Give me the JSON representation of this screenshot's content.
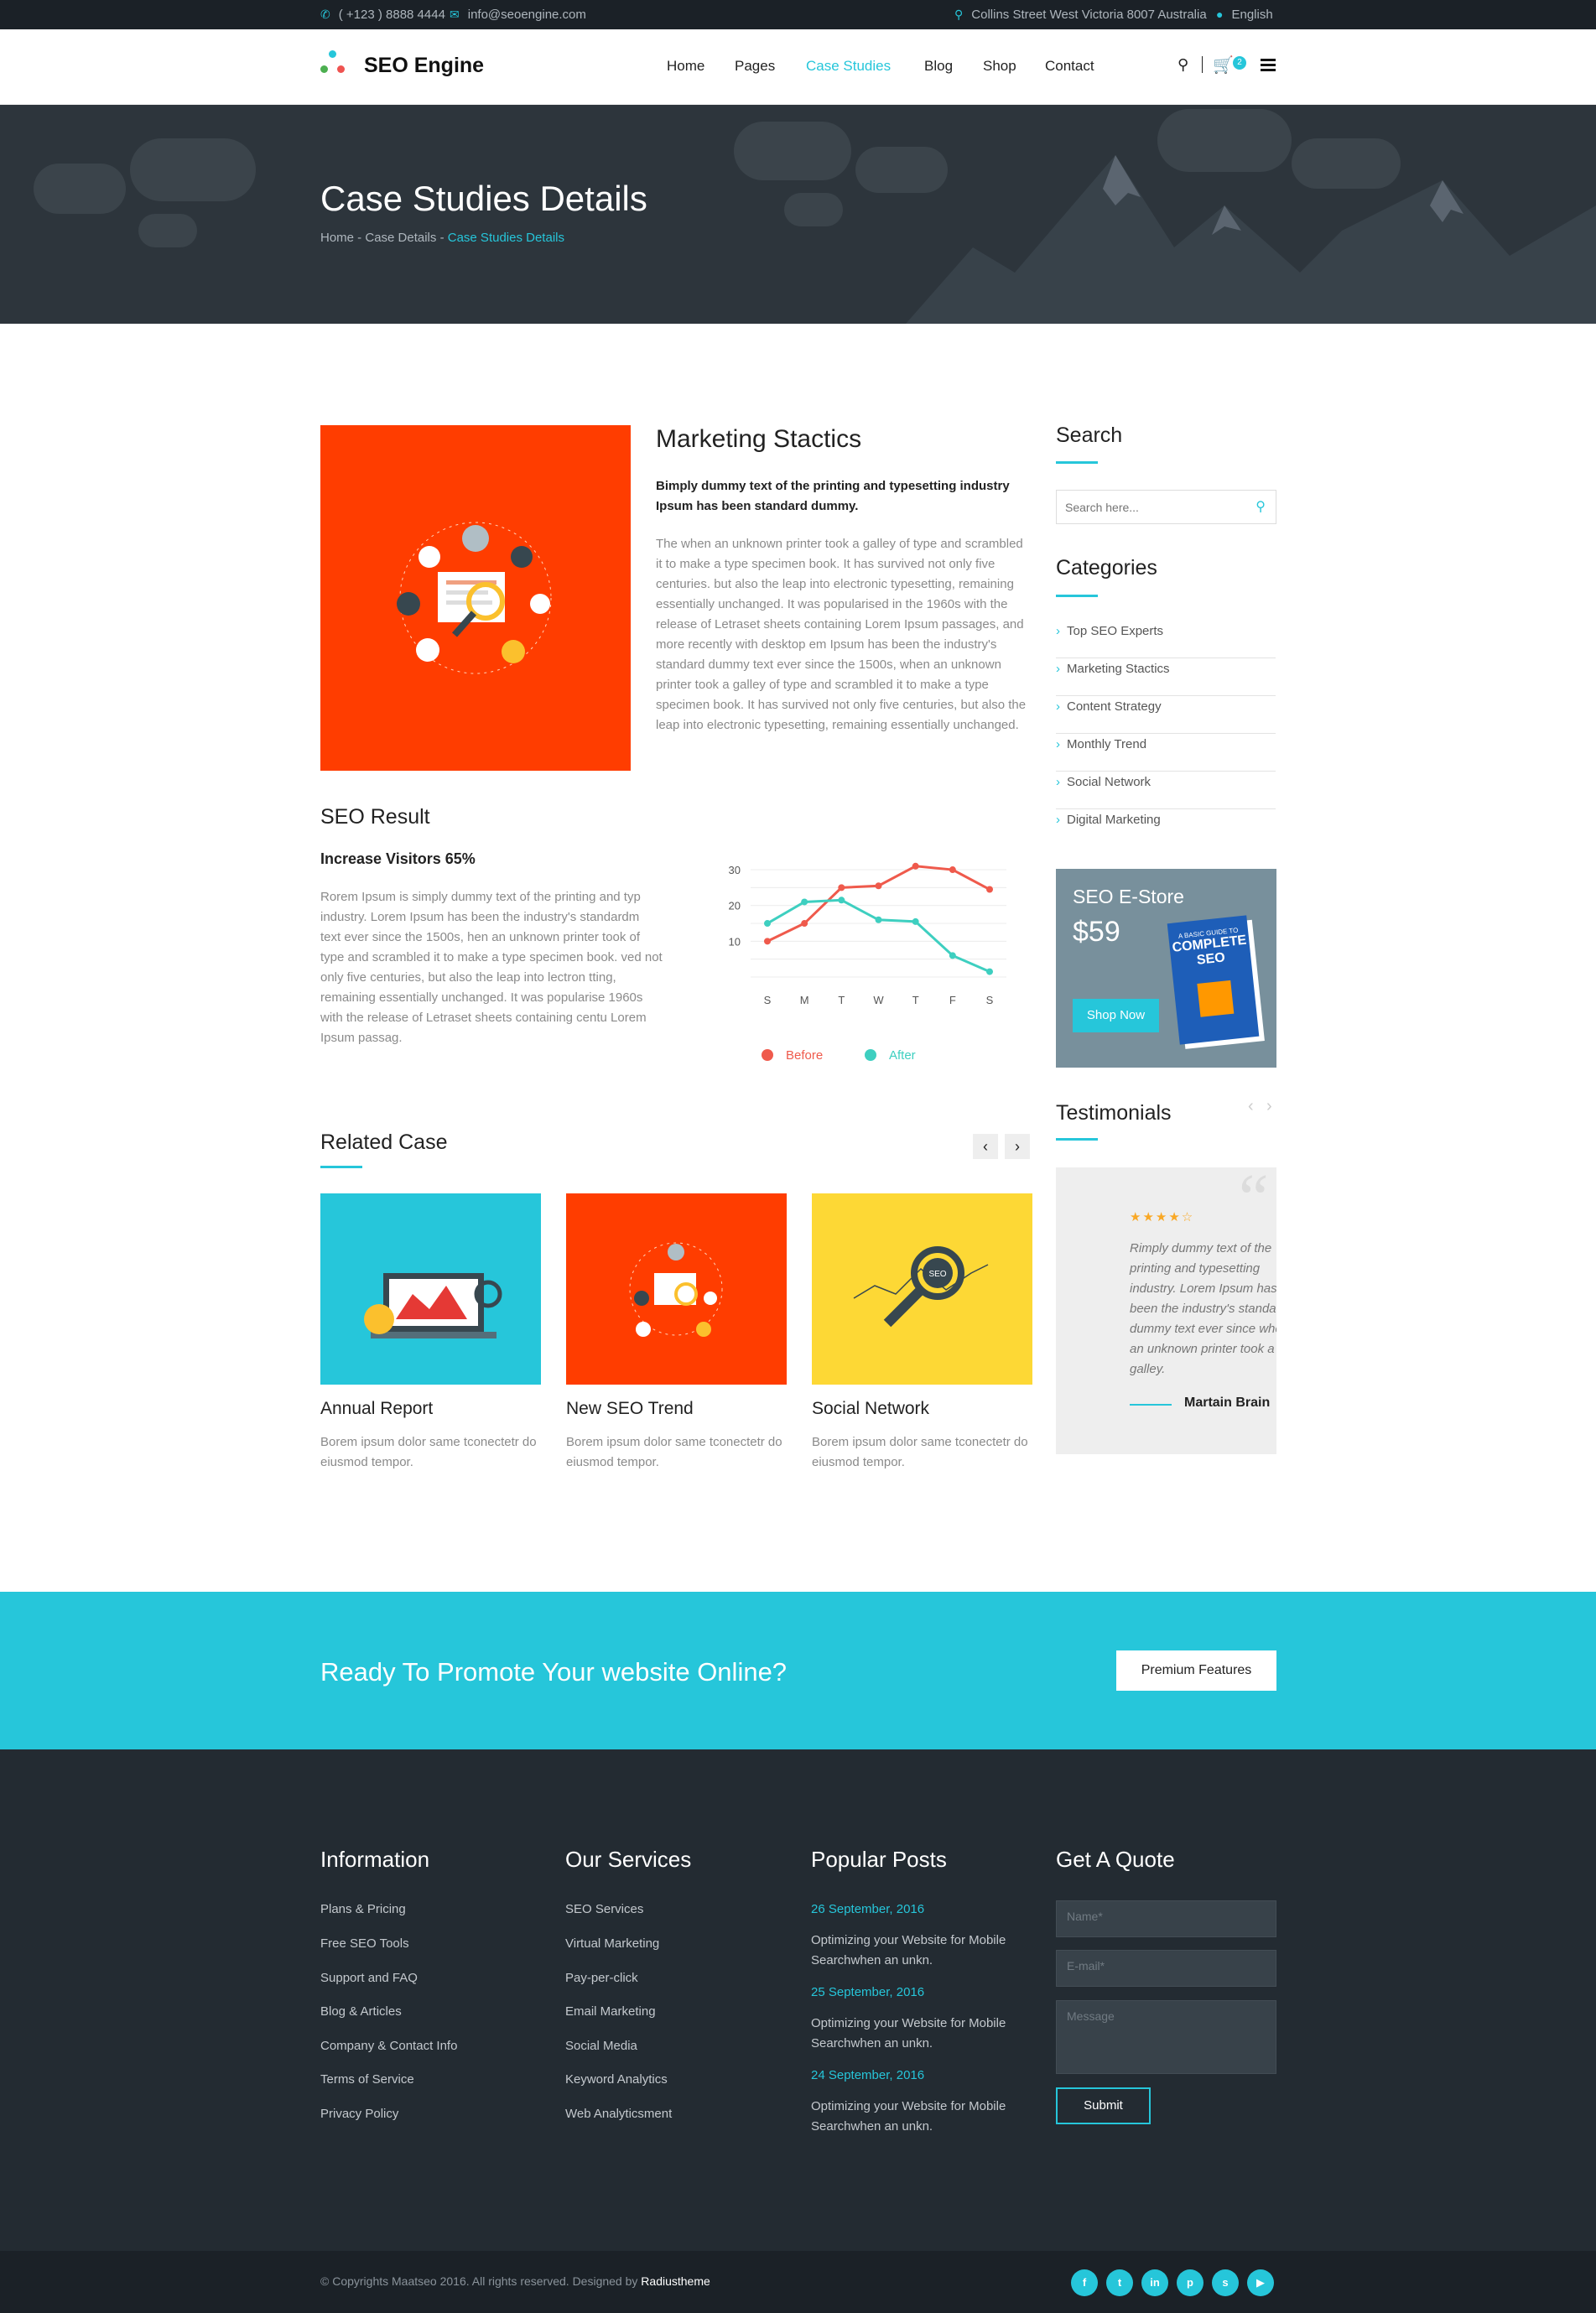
{
  "topbar": {
    "phone": "( +123 ) 8888 4444",
    "email": "info@seoengine.com",
    "address": "Collins Street West Victoria 8007 Australia",
    "language": "English"
  },
  "header": {
    "brand": "SEO Engine",
    "nav": [
      "Home",
      "Pages",
      "Case Studies",
      "Blog",
      "Shop",
      "Contact"
    ],
    "cart_count": "2"
  },
  "banner": {
    "title": "Case Studies Details",
    "breadcrumb": [
      "Home",
      "Case Details",
      "Case Studies Details"
    ],
    "sep": " - "
  },
  "article": {
    "title": "Marketing Stactics",
    "lead": "Bimply dummy text of the printing and typesetting industry Ipsum has been standard dummy.",
    "body": "The when an unknown printer took a galley of type and scrambled it to make a type specimen book. It has survived not only five centuries. but also the leap into electronic typesetting, remaining essentially unchanged. It was popularised in the 1960s with the release of Letraset sheets containing Lorem Ipsum passages, and more recently with desktop em Ipsum has been the industry's standard dummy text ever since the 1500s, when an unknown printer took a galley of type and scrambled it to make a type specimen book. It has survived not only five centuries, but also the leap into electronic typesetting, remaining essentially unchanged."
  },
  "seo_result": {
    "title": "SEO Result",
    "subtitle": "Increase Visitors 65%",
    "body": "Rorem Ipsum is simply dummy text of the printing and typ industry. Lorem Ipsum has been the industry's standardm text ever since the 1500s, hen an unknown printer took of type and scrambled it to make a type specimen book. ved not only five centuries, but also the leap into lectron tting, remaining essentially unchanged. It was popularise 1960s with the release of Letraset sheets containing centu Lorem Ipsum passag."
  },
  "chart_data": {
    "type": "line",
    "categories": [
      "S",
      "M",
      "T",
      "W",
      "T",
      "F",
      "S"
    ],
    "yticks": [
      "10",
      "20",
      "30"
    ],
    "ylim": [
      0,
      34
    ],
    "grid": true,
    "legend_placement": "bottom",
    "series": [
      {
        "name": "Before",
        "color": "#ef5a4c",
        "values": [
          10,
          15,
          25,
          25.5,
          31,
          30,
          24.5
        ]
      },
      {
        "name": "After",
        "color": "#3ecfc0",
        "values": [
          15,
          21,
          21.5,
          16,
          15.5,
          6,
          1.5
        ]
      }
    ]
  },
  "related": {
    "title": "Related Case",
    "items": [
      {
        "title": "Annual Report",
        "text": "Borem ipsum dolor same tconectetr do eiusmod tempor.",
        "bg": "#26c6da"
      },
      {
        "title": "New SEO Trend",
        "text": "Borem ipsum dolor same tconectetr do eiusmod tempor.",
        "bg": "#ff3d00"
      },
      {
        "title": "Social Network",
        "text": "Borem ipsum dolor same tconectetr do eiusmod tempor.",
        "bg": "#fdd835"
      }
    ]
  },
  "sidebar": {
    "search_title": "Search",
    "search_placeholder": "Search here...",
    "categories_title": "Categories",
    "categories": [
      "Top SEO Experts",
      "Marketing Stactics",
      "Content Strategy",
      "Monthly Trend",
      "Social Network",
      "Digital Marketing"
    ],
    "estore": {
      "title": "SEO E-Store",
      "price": "$59",
      "button": "Shop Now",
      "book_small": "A BASIC GUIDE TO",
      "book_big": "COMPLETE SEO"
    },
    "testimonials_title": "Testimonials",
    "testimonial": {
      "stars": "★★★★☆",
      "text": "Rimply dummy text of the printing and typesetting industry. Lorem Ipsum has been the industry's standard dummy text ever since when an unknown printer took a galley.",
      "author": "Martain Brain"
    }
  },
  "cta": {
    "text": "Ready To Promote Your website Online?",
    "button": "Premium Features"
  },
  "footer": {
    "information": {
      "title": "Information",
      "links": [
        "Plans & Pricing",
        "Free SEO Tools",
        "Support and FAQ",
        "Blog & Articles",
        "Company & Contact Info",
        "Terms of Service",
        "Privacy Policy"
      ]
    },
    "services": {
      "title": "Our Services",
      "links": [
        "SEO Services",
        "Virtual Marketing",
        "Pay-per-click",
        "Email Marketing",
        "Social Media",
        "Keyword Analytics",
        "Web Analyticsment"
      ]
    },
    "posts": {
      "title": "Popular Posts",
      "items": [
        {
          "date": "26 September, 2016",
          "text": "Optimizing your Website for Mobile Searchwhen an unkn."
        },
        {
          "date": "25 September, 2016",
          "text": "Optimizing your Website for Mobile Searchwhen an unkn."
        },
        {
          "date": "24 September, 2016",
          "text": "Optimizing your Website for Mobile Searchwhen an unkn."
        }
      ]
    },
    "quote": {
      "title": "Get A Quote",
      "name_ph": "Name*",
      "email_ph": "E-mail*",
      "message_ph": "Message",
      "submit": "Submit"
    }
  },
  "copyright": {
    "text": "© Copyrights Maatseo 2016. All rights reserved. Designed by ",
    "designer": "Radiustheme"
  },
  "social": [
    "f",
    "t",
    "in",
    "p",
    "s",
    "▶"
  ],
  "colors": {
    "accent": "#26c6da",
    "dark": "#232b32",
    "orange": "#ff3d00"
  }
}
